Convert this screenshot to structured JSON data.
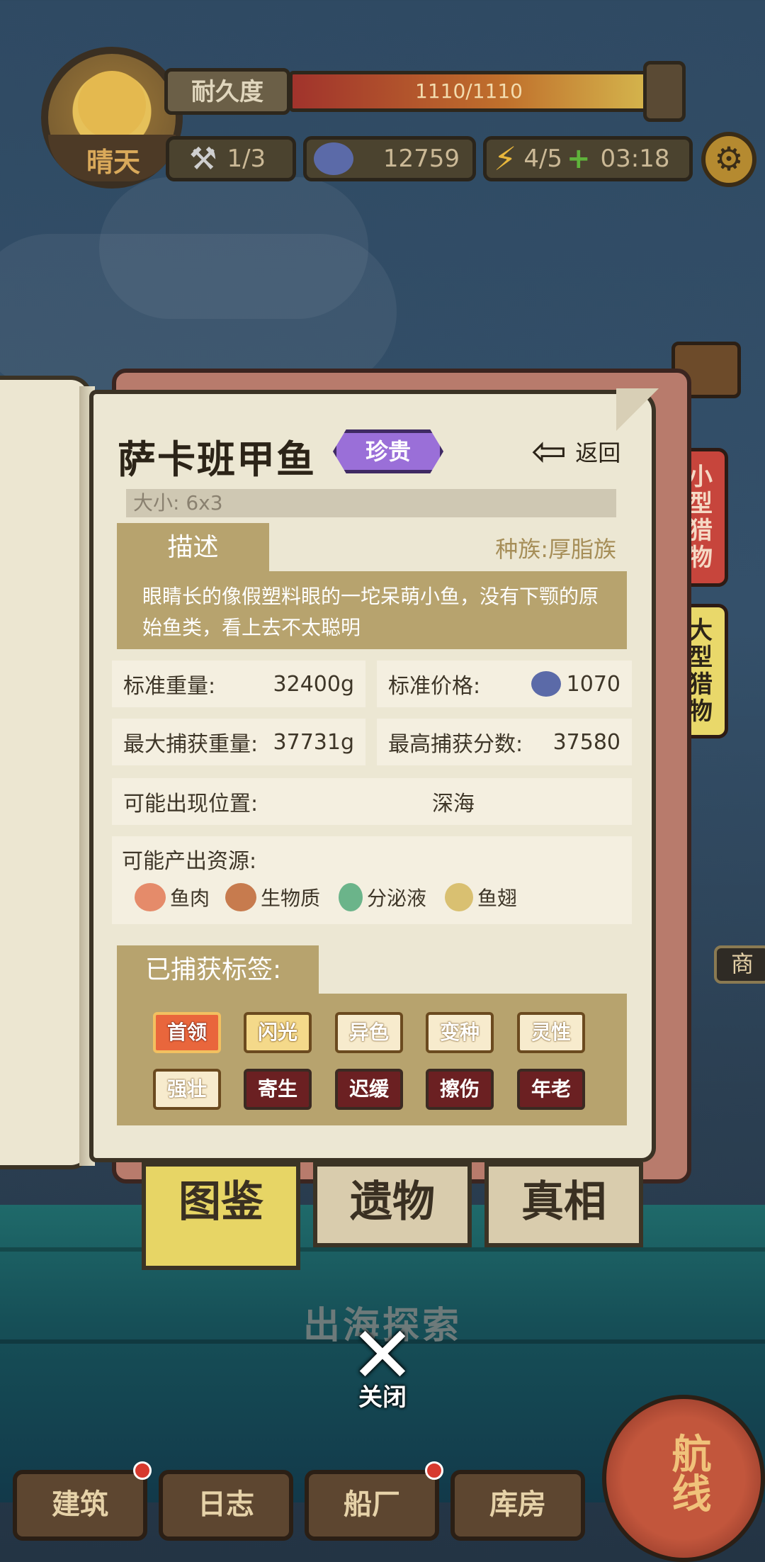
{
  "hud": {
    "weather": "晴天",
    "durability_label": "耐久度",
    "durability_value": "1110/1110",
    "durability_fraction": 1.0,
    "tools": "1/3",
    "coins": "12759",
    "energy": "4/5",
    "timer": "03:18"
  },
  "side_tabs": {
    "small_prey": "小型猎物",
    "large_prey": "大型猎物",
    "merchant": "商人"
  },
  "fish": {
    "name": "萨卡班甲鱼",
    "rarity": "珍贵",
    "back_label": "返回",
    "size": "大小: 6x3",
    "desc_tab": "描述",
    "species": "种族:厚脂族",
    "description": "眼睛长的像假塑料眼的一坨呆萌小鱼，没有下颚的原始鱼类，看上去不太聪明",
    "std_weight_label": "标准重量:",
    "std_weight_value": "32400g",
    "std_price_label": "标准价格:",
    "std_price_value": "1070",
    "max_weight_label": "最大捕获重量:",
    "max_weight_value": "37731g",
    "max_score_label": "最高捕获分数:",
    "max_score_value": "37580",
    "location_label": "可能出现位置:",
    "location_value": "深海",
    "resources_label": "可能产出资源:",
    "resources": [
      "鱼肉",
      "生物质",
      "分泌液",
      "鱼翅"
    ],
    "tags_label": "已捕获标签:",
    "tags": [
      "首领",
      "闪光",
      "异色",
      "变种",
      "灵性",
      "强壮",
      "寄生",
      "迟缓",
      "擦伤",
      "年老"
    ]
  },
  "book_tabs": [
    "图鉴",
    "遗物",
    "真相"
  ],
  "explore": "出海探索",
  "close_label": "关闭",
  "nav": [
    "建筑",
    "日志",
    "船厂",
    "库房"
  ],
  "route": "航线"
}
